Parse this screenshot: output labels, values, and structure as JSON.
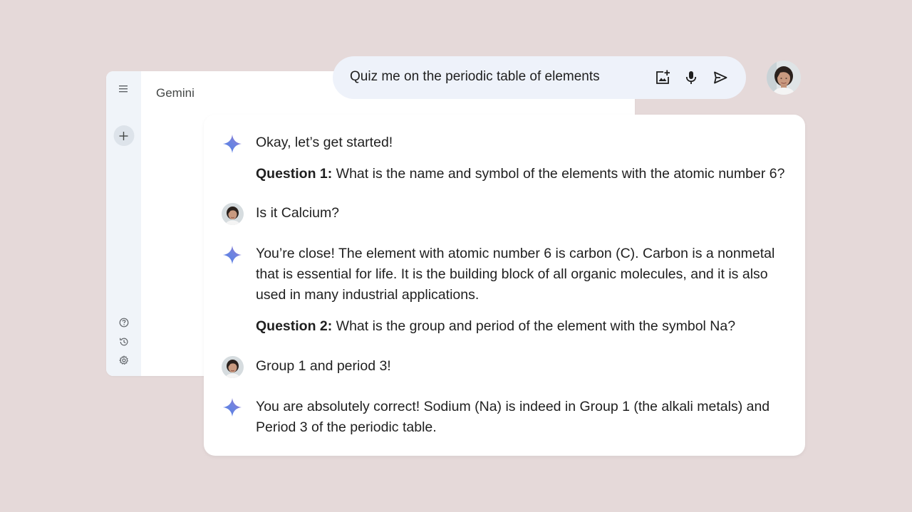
{
  "app": {
    "title": "Gemini",
    "rail_icons": [
      "menu-icon",
      "plus-icon",
      "help-icon",
      "history-icon",
      "settings-icon"
    ]
  },
  "prompt": {
    "text": "Quiz me on the periodic table of elements",
    "icons": [
      "add-image-icon",
      "mic-icon",
      "send-icon"
    ]
  },
  "conversation": {
    "m1": {
      "line1": "Okay, let’s get started!",
      "q_label": "Question 1:",
      "q_text": " What is the name and symbol of the elements with the atomic number 6?"
    },
    "m2": {
      "text": "Is it Calcium?"
    },
    "m3": {
      "line1": "You’re close! The element with atomic number 6 is carbon (C). Carbon is a nonmetal",
      "line2": "that is essential for life. It is the building block of all organic molecules, and it is also",
      "line3": "used in many industrial applications.",
      "q_label": "Question 2:",
      "q_text": " What is the group and period of the element with the symbol Na?"
    },
    "m4": {
      "text": "Group 1 and period 3!"
    },
    "m5": {
      "line1": "You are absolutely correct! Sodium (Na) is indeed in Group 1 (the alkali metals) and",
      "line2": "Period 3 of the periodic table."
    }
  },
  "colors": {
    "background": "#e5d9d9",
    "rail": "#f0f4f9",
    "prompt_pill": "#eef2fa",
    "spark_blue": "#4f7fe6",
    "spark_purple": "#9b72cb"
  }
}
